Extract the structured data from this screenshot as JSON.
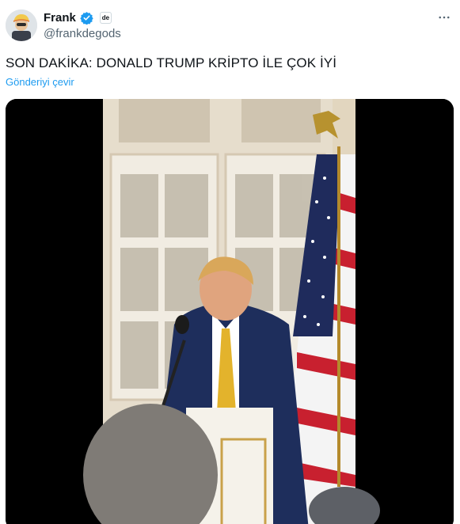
{
  "author": {
    "display_name": "Frank",
    "handle": "@frankdegods",
    "verified": true,
    "affiliate_badge_text": "de",
    "verified_color": "#1d9bf0"
  },
  "tweet": {
    "text": "SON DAKİKA: DONALD TRUMP KRİPTO İLE ÇOK İYİ",
    "translate_label": "Gönderiyi çevir"
  },
  "media": {
    "type": "video",
    "icon": "video-frame"
  },
  "icons": {
    "more": "more-options-icon",
    "verified": "verified-badge-icon"
  },
  "colors": {
    "link": "#1d9bf0",
    "text": "#0f1419",
    "secondary": "#536471"
  }
}
